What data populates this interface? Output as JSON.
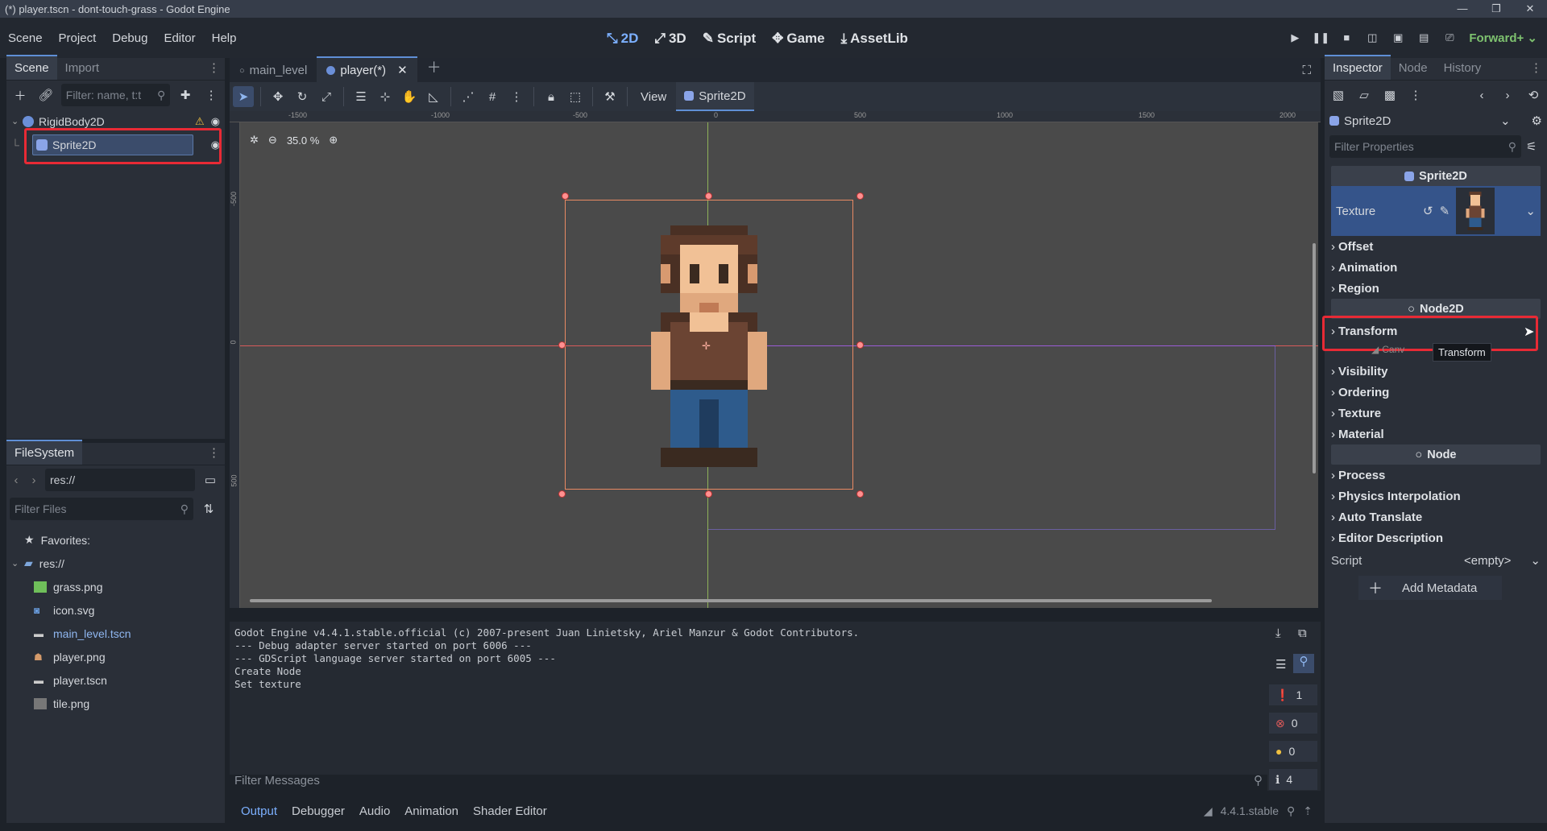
{
  "window": {
    "title": "(*) player.tscn - dont-touch-grass - Godot Engine"
  },
  "menu": [
    "Scene",
    "Project",
    "Debug",
    "Editor",
    "Help"
  ],
  "workspaces": [
    {
      "label": "2D",
      "icon": "2d-icon",
      "active": true
    },
    {
      "label": "3D",
      "icon": "3d-icon",
      "active": false
    },
    {
      "label": "Script",
      "icon": "script-icon",
      "active": false
    },
    {
      "label": "Game",
      "icon": "game-icon",
      "active": false
    },
    {
      "label": "AssetLib",
      "icon": "assetlib-icon",
      "active": false
    }
  ],
  "renderer": "Forward+",
  "scene_dock": {
    "tabs": [
      "Scene",
      "Import"
    ],
    "filter_placeholder": "Filter: name, t:t",
    "nodes": [
      {
        "name": "RigidBody2D",
        "icon": "rigidbody2d-icon"
      },
      {
        "name": "Sprite2D",
        "icon": "sprite2d-icon"
      }
    ]
  },
  "filesystem": {
    "tab": "FileSystem",
    "path": "res://",
    "filter_placeholder": "Filter Files",
    "favorites_label": "Favorites:",
    "root": "res://",
    "files": [
      {
        "name": "grass.png",
        "icon": "image-icon"
      },
      {
        "name": "icon.svg",
        "icon": "svg-icon"
      },
      {
        "name": "main_level.tscn",
        "icon": "scene-file-icon"
      },
      {
        "name": "player.png",
        "icon": "image-icon"
      },
      {
        "name": "player.tscn",
        "icon": "scene-file-icon"
      },
      {
        "name": "tile.png",
        "icon": "image-icon"
      }
    ]
  },
  "viewport": {
    "tabs": [
      {
        "label": "main_level",
        "active": false
      },
      {
        "label": "player(*)",
        "active": true
      }
    ],
    "view_label": "View",
    "selected_node": "Sprite2D",
    "zoom": "35.0 %",
    "ruler_labels_h": [
      "-1500",
      "-1000",
      "-500",
      "0",
      "500",
      "1000",
      "1500",
      "2000"
    ],
    "ruler_labels_v": [
      "-500",
      "0",
      "500"
    ]
  },
  "output": {
    "lines": [
      "Godot Engine v4.4.1.stable.official (c) 2007-present Juan Linietsky, Ariel Manzur & Godot Contributors.",
      "--- Debug adapter server started on port 6006 ---",
      "--- GDScript language server started on port 6005 ---",
      "Create Node",
      "Set texture"
    ],
    "filter_placeholder": "Filter Messages",
    "counts": {
      "messages": "1",
      "errors": "0",
      "warnings": "0",
      "info": "4"
    }
  },
  "bottom_tabs": [
    "Output",
    "Debugger",
    "Audio",
    "Animation",
    "Shader Editor"
  ],
  "version": "4.4.1.stable",
  "inspector": {
    "tabs": [
      "Inspector",
      "Node",
      "History"
    ],
    "object": "Sprite2D",
    "filter_placeholder": "Filter Properties",
    "class_sprite": "Sprite2D",
    "texture_label": "Texture",
    "sprite_sections": [
      "Offset",
      "Animation",
      "Region"
    ],
    "class_node2d": "Node2D",
    "transform_label": "Transform",
    "tooltip": "Transform",
    "canvas_partial": "Canv",
    "canvas_sections": [
      "Visibility",
      "Ordering",
      "Texture",
      "Material"
    ],
    "class_node": "Node",
    "node_sections": [
      "Process",
      "Physics Interpolation",
      "Auto Translate",
      "Editor Description"
    ],
    "script_label": "Script",
    "script_value": "<empty>",
    "add_metadata": "Add Metadata"
  },
  "colors": {
    "accent": "#5f8fd6",
    "highlight_box": "#e82a35",
    "selection": "#e98a63"
  }
}
